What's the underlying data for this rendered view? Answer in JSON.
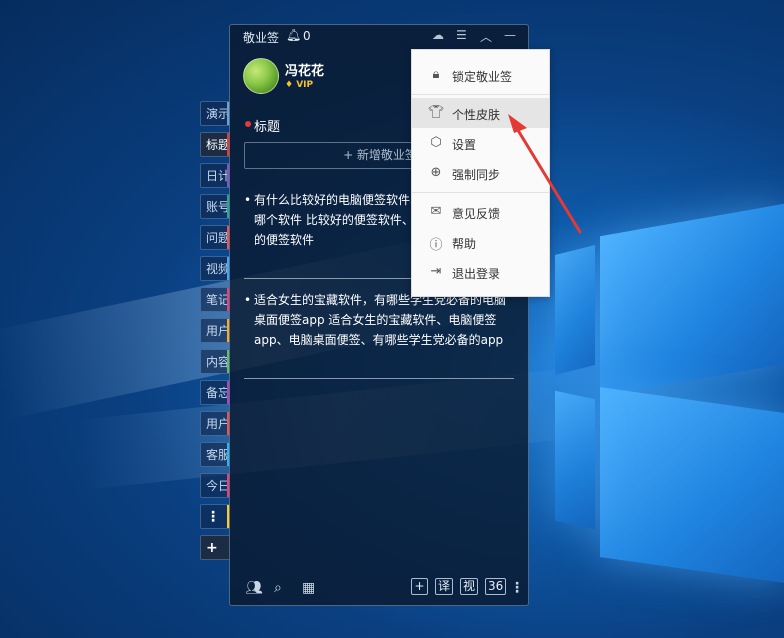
{
  "app": {
    "title": "敬业签",
    "notification_count": "0"
  },
  "side_tabs": [
    "演示",
    "标题",
    "日计",
    "账号",
    "问题",
    "视频",
    "笔记",
    "用户",
    "内容",
    "备忘",
    "用户",
    "客服",
    "今日"
  ],
  "side_more": "⋮",
  "side_add": "+",
  "user": {
    "name": "冯花花",
    "badge": "VIP"
  },
  "section": {
    "title": "标题"
  },
  "add_button": "+ 新增敬业签",
  "notes": [
    {
      "text": "有什么比较好的电脑便签软件、电脑桌面便签是哪个软件 比较好的便签软件、哪个便签软件好用的便签软件"
    },
    {
      "text": "适合女生的宝藏软件，有哪些学生党必备的电脑桌面便签app 适合女生的宝藏软件、电脑便签app、电脑桌面便签、有哪些学生党必备的app"
    }
  ],
  "bottom_bar": {
    "boxes": [
      "+",
      "译",
      "视",
      "36"
    ],
    "more": "⋮"
  },
  "menu": {
    "items": [
      {
        "label": "锁定敬业签",
        "icon": "lock-icon"
      },
      {
        "label": "个性皮肤",
        "icon": "shirt-icon"
      },
      {
        "label": "设置",
        "icon": "settings-hexagon-icon"
      },
      {
        "label": "强制同步",
        "icon": "sync-up-icon"
      },
      {
        "label": "意见反馈",
        "icon": "mail-icon"
      },
      {
        "label": "帮助",
        "icon": "help-icon"
      },
      {
        "label": "退出登录",
        "icon": "logout-icon"
      }
    ]
  },
  "colors": {
    "accent_red": "#e53935",
    "vip_gold": "#f5c12e",
    "panel_bg": "#0a1a30",
    "menu_bg": "#fafafa"
  }
}
